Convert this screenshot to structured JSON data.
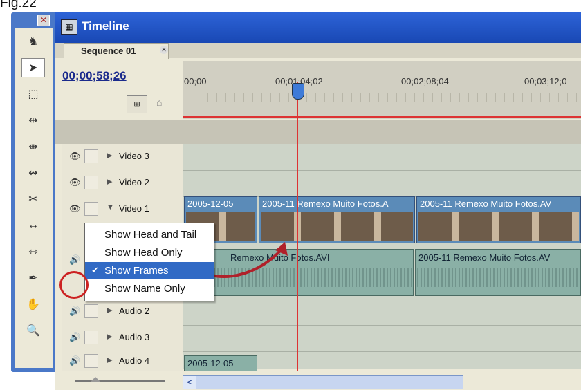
{
  "figure_label": "Fig.22",
  "tools_palette": {
    "close_glyph": "✕",
    "tools": [
      {
        "name": "horse-icon",
        "glyph": "♞"
      },
      {
        "name": "selection-tool-icon",
        "glyph": "➤"
      },
      {
        "name": "track-select-tool-icon",
        "glyph": "⬚"
      },
      {
        "name": "ripple-edit-tool-icon",
        "glyph": "⇹"
      },
      {
        "name": "rolling-edit-tool-icon",
        "glyph": "⇼"
      },
      {
        "name": "rate-stretch-tool-icon",
        "glyph": "↭"
      },
      {
        "name": "razor-tool-icon",
        "glyph": "✂"
      },
      {
        "name": "slip-tool-icon",
        "glyph": "↔"
      },
      {
        "name": "slide-tool-icon",
        "glyph": "⇿"
      },
      {
        "name": "pen-tool-icon",
        "glyph": "✒"
      },
      {
        "name": "hand-tool-icon",
        "glyph": "✋"
      },
      {
        "name": "zoom-tool-icon",
        "glyph": "🔍"
      }
    ]
  },
  "window": {
    "title": "Timeline",
    "tab_label": "Sequence 01",
    "tab_close": "✕",
    "timecode": "00;00;58;26",
    "snap_glyph": "⊞",
    "marker_glyph": "⌂"
  },
  "ruler": {
    "ticks": [
      "00;00",
      "00;01;04;02",
      "00;02;08;04",
      "00;03;12;0"
    ]
  },
  "tracks": [
    {
      "name": "Video 3",
      "kind": "video",
      "eye_glyph": "👁",
      "expand": "▶"
    },
    {
      "name": "Video 2",
      "kind": "video",
      "eye_glyph": "👁",
      "expand": "▶"
    },
    {
      "name": "Video 1",
      "kind": "video",
      "eye_glyph": "👁",
      "expand": "▼"
    },
    {
      "name": "Audio 2",
      "kind": "audio",
      "speaker_glyph": "🔊",
      "expand": "▶"
    },
    {
      "name": "Audio 3",
      "kind": "audio",
      "speaker_glyph": "🔊",
      "expand": "▶"
    },
    {
      "name": "Audio 4",
      "kind": "audio",
      "speaker_glyph": "🔊",
      "expand": "▶"
    }
  ],
  "clips": {
    "video1": [
      "2005-12-05",
      "2005-11 Remexo Muito Fotos.A",
      "2005-11 Remexo Muito Fotos.AV"
    ],
    "audio1": [
      "Remexo Muito Fotos.AVI",
      "2005-11 Remexo Muito Fotos.AV"
    ],
    "audio4": "2005-12-05"
  },
  "context_menu": {
    "items": [
      {
        "label": "Show Head and Tail",
        "selected": false
      },
      {
        "label": "Show Head Only",
        "selected": false
      },
      {
        "label": "Show Frames",
        "selected": true
      },
      {
        "label": "Show Name Only",
        "selected": false
      }
    ],
    "check_glyph": "✔"
  },
  "bottom": {
    "scroll_left_glyph": "<"
  },
  "colors": {
    "title_blue": "#1948b4",
    "playhead_red": "#dd3333",
    "menu_highlight": "#316ac5",
    "annotation_red": "#cc2222"
  }
}
